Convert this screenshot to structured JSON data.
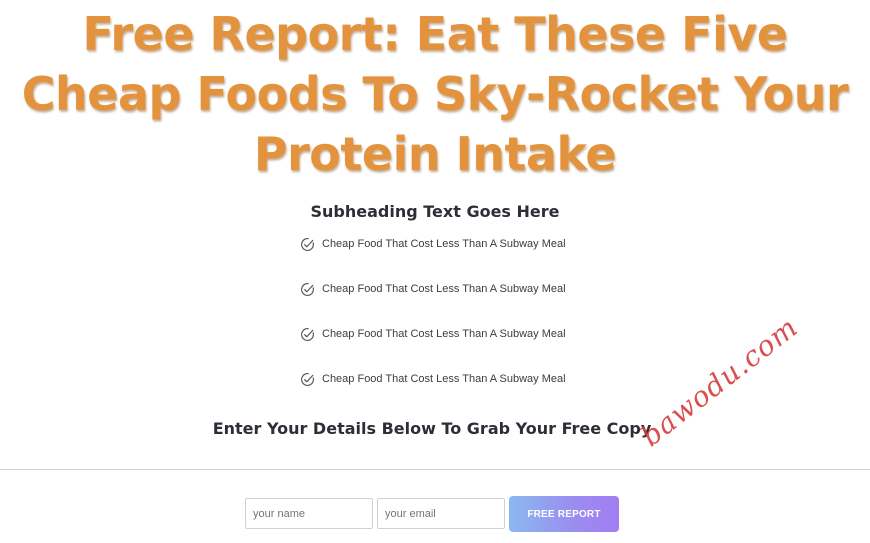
{
  "headline": {
    "text": "Free Report: Eat These Five Cheap Foods To Sky-Rocket Your Protein Intake"
  },
  "subheading": {
    "text": "Subheading Text Goes Here"
  },
  "benefits": {
    "icon": "check-circle-icon",
    "items": [
      "Cheap Food That Cost Less Than A Subway Meal",
      "Cheap Food That Cost Less Than A Subway Meal",
      "Cheap Food That Cost Less Than A Subway Meal",
      "Cheap Food That Cost Less Than A Subway Meal"
    ]
  },
  "cta": {
    "heading": "Enter Your Details Below To Grab Your Free Copy"
  },
  "form": {
    "name_placeholder": "your name",
    "email_placeholder": "your email",
    "submit_label": "FREE REPORT"
  },
  "watermark": {
    "text": "bawodu.com"
  },
  "colors": {
    "headline": "#e3933e",
    "button_gradient_start": "#8ab9f0",
    "button_gradient_end": "#a27df2",
    "watermark": "#d63b3b"
  }
}
